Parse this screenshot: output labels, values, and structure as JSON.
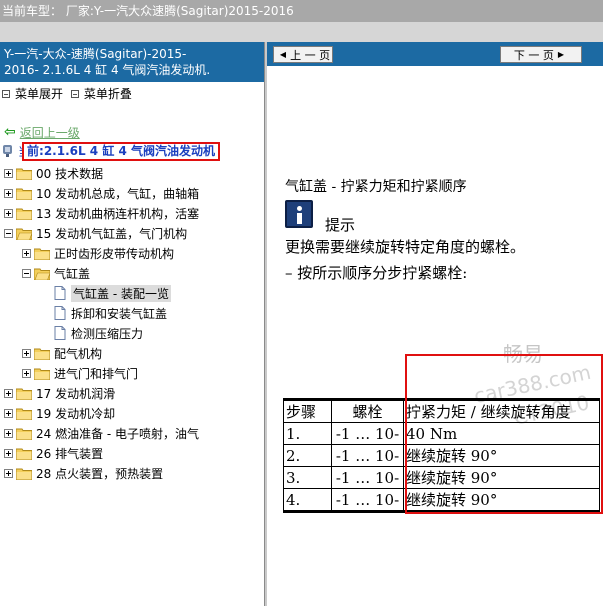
{
  "title_bar": {
    "text": "当前车型：   厂家:Y-一汽大众速腾(Sagitar)2015-2016"
  },
  "left_pane": {
    "header": {
      "line1": "Y-一汽-大众-速腾(Sagitar)-2015-",
      "line2": "2016- 2.1.6L 4 缸 4 气阀汽油发动机."
    },
    "menu": {
      "expand": "菜单展开",
      "collapse": "菜单折叠"
    },
    "go_up": "返回上一级",
    "current": {
      "prefix": "当",
      "label": "前:2.1.6L 4 缸 4 气阀汽油发动机"
    },
    "tree": [
      {
        "label": "00 技术数据"
      },
      {
        "label": "10 发动机总成，气缸，曲轴箱"
      },
      {
        "label": "13 发动机曲柄连杆机构，活塞"
      },
      {
        "label": "15 发动机气缸盖，气门机构"
      },
      {
        "label": "正时齿形皮带传动机构"
      },
      {
        "label": "气缸盖"
      },
      {
        "label": "气缸盖 - 装配一览"
      },
      {
        "label": "拆卸和安装气缸盖"
      },
      {
        "label": "检测压缩压力"
      },
      {
        "label": "配气机构"
      },
      {
        "label": "进气门和排气门"
      },
      {
        "label": "17 发动机润滑"
      },
      {
        "label": "19 发动机冷却"
      },
      {
        "label": "24 燃油准备 - 电子喷射，油气"
      },
      {
        "label": "26 排气装置"
      },
      {
        "label": "28 点火装置，预热装置"
      }
    ]
  },
  "right_pane": {
    "prev_label": "上 一 页",
    "next_label": "下 一 页",
    "section_title": "气缸盖 - 拧紧力矩和拧紧顺序",
    "hint_label": "提示",
    "note1": "更换需要继续旋转特定角度的螺栓。",
    "note2": "–  按所示顺序分步拧紧螺栓:",
    "watermark": {
      "w1": "畅易",
      "w2": "car388.com",
      "w3": "CY2010"
    },
    "table": {
      "headers": [
        "步骤",
        "螺栓",
        "拧紧力矩 / 继续旋转角度"
      ],
      "rows": [
        [
          "1.",
          "-1 … 10-",
          "40 Nm"
        ],
        [
          "2.",
          "-1 … 10-",
          "继续旋转 90°"
        ],
        [
          "3.",
          "-1 … 10-",
          "继续旋转 90°"
        ],
        [
          "4.",
          "-1 … 10-",
          "继续旋转 90°"
        ]
      ]
    }
  },
  "colors": {
    "header_blue": "#1c6aa3",
    "highlight_red": "#e01010",
    "link_blue": "#1a3fbf",
    "title_gray": "#a8a8a8"
  }
}
